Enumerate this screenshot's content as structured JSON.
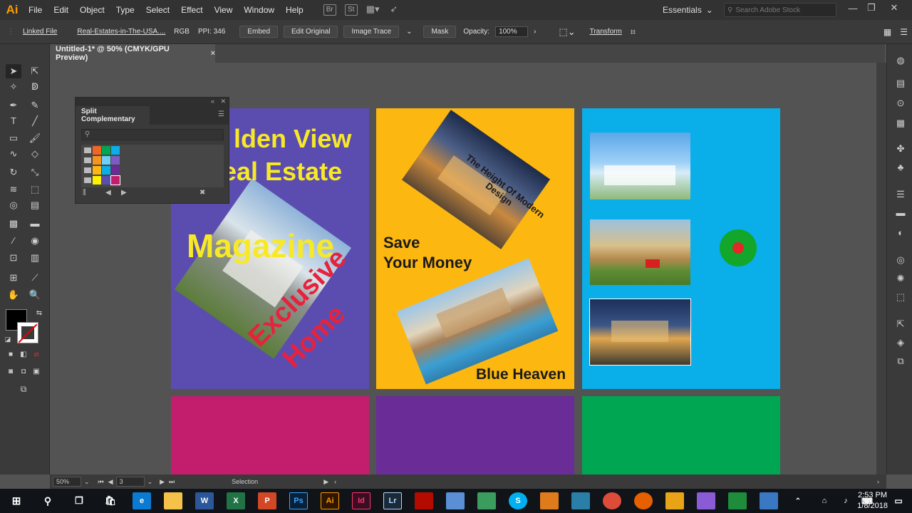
{
  "app": {
    "logo": "Ai",
    "brand_color": "#ff9a00"
  },
  "menu": [
    "File",
    "Edit",
    "Object",
    "Type",
    "Select",
    "Effect",
    "View",
    "Window",
    "Help"
  ],
  "menu_icons": [
    "br-icon",
    "stock-icon",
    "arrange-icon",
    "gpu-icon"
  ],
  "menu_icon_glyphs": {
    "br": "Br",
    "st": "St"
  },
  "workspace": {
    "label": "Essentials",
    "search_placeholder": "Search Adobe Stock"
  },
  "control": {
    "linked_file": "Linked File",
    "file_name": "Real-Estates-in-The-USA....",
    "color_mode": "RGB",
    "ppi": "PPI: 346",
    "embed": "Embed",
    "edit_original": "Edit Original",
    "image_trace": "Image Trace",
    "mask": "Mask",
    "opacity_label": "Opacity:",
    "opacity_value": "100%",
    "transform": "Transform"
  },
  "document_tab": {
    "title": "Untitled-1* @ 50% (CMYK/GPU Preview)",
    "close": "×"
  },
  "panel": {
    "title": "Split Complementary",
    "swatch_rows": [
      [
        "#f26522",
        "#00a651",
        "#0aaee8"
      ],
      [
        "#f7941d",
        "#6dcff6",
        "#7c5cc4"
      ],
      [
        "#fcb711",
        "#0aaee8",
        "#6a2c97"
      ],
      [
        "#fff200",
        "#5b4db0",
        "#c21e6d"
      ]
    ]
  },
  "artboards": {
    "ab1": {
      "headline_1": "lden View",
      "headline_2": "eal Estate",
      "magazine": "Magazine",
      "exclusive": "Exclusive",
      "home": "Home"
    },
    "ab2": {
      "tagline": "The Height Of Modern Design",
      "save_1": "Save",
      "save_2": "Your Money",
      "blue_heaven": "Blue Heaven"
    }
  },
  "status": {
    "zoom": "50%",
    "artboard": "3",
    "tool": "Selection"
  },
  "taskbar": {
    "apps": [
      {
        "name": "windows",
        "label": "",
        "color": "#101418"
      },
      {
        "name": "search",
        "label": "",
        "color": "#101418"
      },
      {
        "name": "task-view",
        "label": "",
        "color": "#101418"
      },
      {
        "name": "store",
        "label": "",
        "color": "#101418"
      },
      {
        "name": "edge",
        "label": "e",
        "color": "#0b7ad3"
      },
      {
        "name": "explorer",
        "label": "",
        "color": "#f5c249"
      },
      {
        "name": "word",
        "label": "W",
        "color": "#2b579a"
      },
      {
        "name": "excel",
        "label": "X",
        "color": "#217346"
      },
      {
        "name": "powerpoint",
        "label": "P",
        "color": "#d24726"
      },
      {
        "name": "photoshop",
        "label": "Ps",
        "color": "#0a1f38"
      },
      {
        "name": "illustrator",
        "label": "Ai",
        "color": "#2e1600"
      },
      {
        "name": "indesign",
        "label": "Id",
        "color": "#3a0e22"
      },
      {
        "name": "lightroom",
        "label": "Lr",
        "color": "#1b2a38"
      },
      {
        "name": "acrobat",
        "label": "",
        "color": "#b30b00"
      },
      {
        "name": "app-1",
        "label": "",
        "color": "#5a8fd6"
      },
      {
        "name": "app-2",
        "label": "",
        "color": "#3a9d5d"
      },
      {
        "name": "skype",
        "label": "S",
        "color": "#00aff0"
      },
      {
        "name": "app-3",
        "label": "",
        "color": "#e07b1c"
      },
      {
        "name": "app-4",
        "label": "",
        "color": "#2a7fa8"
      },
      {
        "name": "chrome",
        "label": "",
        "color": "#dd4b39"
      },
      {
        "name": "firefox",
        "label": "",
        "color": "#e66000"
      },
      {
        "name": "app-5",
        "label": "",
        "color": "#e8a317"
      },
      {
        "name": "app-6",
        "label": "",
        "color": "#8a5bd6"
      },
      {
        "name": "app-7",
        "label": "",
        "color": "#1e8c3a"
      },
      {
        "name": "app-8",
        "label": "",
        "color": "#3a78c4"
      }
    ],
    "time": "2:53 PM",
    "date": "1/8/2018"
  }
}
